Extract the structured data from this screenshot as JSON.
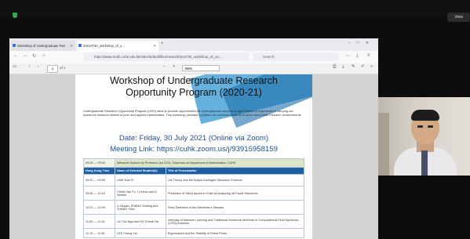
{
  "zoom": {
    "view_label": "View"
  },
  "browser": {
    "tabs": [
      {
        "label": "Workshop of Undergraduate Res",
        "active": false
      },
      {
        "label": "20210730_workshop_of_u...",
        "active": true
      }
    ],
    "url": "https://www.math.cuhk.edu.hk/sites/default/files/news/20210730_workshop_of_un...",
    "search_placeholder": "Search"
  },
  "pdf_toolbar": {
    "page_number": "1",
    "page_total": "of 1",
    "zoom_value": "86%"
  },
  "document": {
    "title_line1": "Workshop of Undergraduate Research",
    "title_line2": "Opportunity Program (2020-21)",
    "intro": "Undergraduate Research Opportunity Program (URO) aims to provide opportunities for undergraduate students to gain hands-on experience in carrying out academic research related to pure and applied mathematics. This workshop provides a platform for selected students to share about their research achievements.",
    "date_line": "Date: Friday, 30 July 2021 (Online via Zoom)",
    "meeting_line": "Meeting Link: https://cuhk.zoom.us/j/93915958159",
    "welcome": {
      "time": "09:25 — 09:30",
      "text": "Welcome Speech by Professor Jun ZOU, Chairman of Department of Mathematics, CUHK"
    },
    "table_headers": {
      "time": "Hong Kong Time",
      "names": "Name of Selected Student(s)",
      "title": "Title of Presentation"
    },
    "rows": [
      {
        "time": "09:30 — 09:55",
        "names": "LAW Sum Ki",
        "title": "Ulc Theory and the Bolyai-Carriegee Steuusom Formula"
      },
      {
        "time": "09:55 — 10:20",
        "names": "CHAN Yan Fu, LI Kevin and LI Weiwei",
        "title": "Prediction of Sleep Apnea in Child by Analyzing 3d Facial Structures"
      },
      {
        "time": "10:20 — 10:45",
        "names": "LI Muyao, ZHANG Xinfang and ZHANG Yifan",
        "title": "Early Detection of the Alzheimer's Disease"
      },
      {
        "time": "11:00 — 11:15",
        "names": "LIU Tsz Nga and HO Cheuk Hin",
        "title": "Interplay of Machine Learning and Traditional Numerical Methods in Computational Fluid Dynamics (CFD) problems"
      },
      {
        "time": "11:15 — 11:30",
        "names": "LEE Chung Yin",
        "title": "Eigenvalues and the Stability of Shear Flows"
      }
    ]
  }
}
